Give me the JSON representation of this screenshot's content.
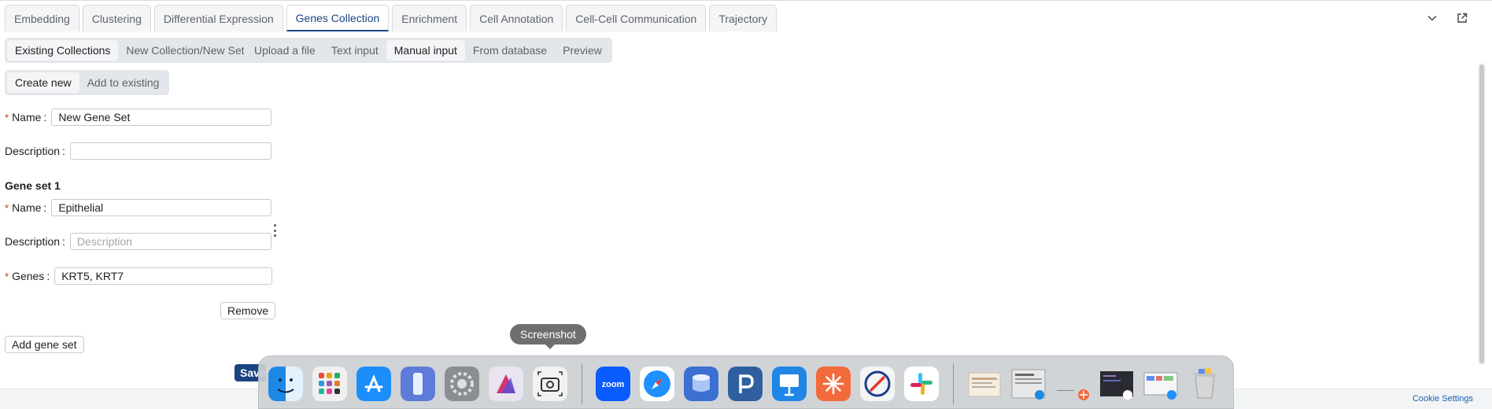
{
  "tabs": [
    {
      "label": "Embedding",
      "active": false
    },
    {
      "label": "Clustering",
      "active": false
    },
    {
      "label": "Differential Expression",
      "active": false
    },
    {
      "label": "Genes Collection",
      "active": true
    },
    {
      "label": "Enrichment",
      "active": false
    },
    {
      "label": "Cell Annotation",
      "active": false
    },
    {
      "label": "Cell-Cell Communication",
      "active": false
    },
    {
      "label": "Trajectory",
      "active": false
    }
  ],
  "collection_mode": {
    "options": [
      "Existing Collections",
      "New Collection/New Set"
    ],
    "selected": "Existing Collections"
  },
  "input_mode": {
    "options": [
      "Upload a file",
      "Text input",
      "Manual input",
      "From database",
      "Preview"
    ],
    "selected": "Manual input"
  },
  "create_mode": {
    "options": [
      "Create new",
      "Add to existing"
    ],
    "selected": "Create new"
  },
  "collection": {
    "name_label": "Name",
    "name_value": "New Gene Set",
    "description_label": "Description",
    "description_value": ""
  },
  "gene_set": {
    "title": "Gene set 1",
    "name_label": "Name",
    "name_value": "Epithelial",
    "description_label": "Description",
    "description_placeholder": "Description",
    "genes_label": "Genes",
    "genes_value": "KRT5, KRT7",
    "remove_label": "Remove"
  },
  "add_gene_set_label": "Add gene set",
  "save_label": "Save",
  "tooltip": "Screenshot",
  "cookie_label": "Cookie Settings",
  "dock_apps": [
    {
      "icon": "finder-icon",
      "color": "#1e88e5"
    },
    {
      "icon": "launchpad-icon",
      "color": "#f0f0f0"
    },
    {
      "icon": "app-store-icon",
      "color": "#1c8ef9"
    },
    {
      "icon": "iphone-mirroring-icon",
      "color": "#5d7bd8"
    },
    {
      "icon": "system-settings-icon",
      "color": "#8a8d93"
    },
    {
      "icon": "affinity-icon",
      "color": "#e9e4f0"
    },
    {
      "icon": "screenshot-icon",
      "color": "#f2f2f2"
    },
    {
      "icon": "zoom-icon",
      "color": "#0b5cff"
    },
    {
      "icon": "safari-icon",
      "color": "#1e90ff"
    },
    {
      "icon": "database-icon",
      "color": "#3b6fd1"
    },
    {
      "icon": "p-app-icon",
      "color": "#2f5f9e"
    },
    {
      "icon": "keynote-icon",
      "color": "#1f86e6"
    },
    {
      "icon": "claude-icon",
      "color": "#f26a3b"
    },
    {
      "icon": "navigator-icon",
      "color": "#f4f4f4"
    },
    {
      "icon": "slack-icon",
      "color": "#ffffff"
    },
    {
      "icon": "document-thumbnail-icon",
      "color": "#f4ede0"
    },
    {
      "icon": "window-thumbnail-icon",
      "color": "#e8e8e8"
    },
    {
      "icon": "minimized-window-icon",
      "color": "#f0f0f0"
    },
    {
      "icon": "terminal-thumbnail-icon",
      "color": "#2a2a33"
    },
    {
      "icon": "browser-thumbnail-icon",
      "color": "#f6f6f6"
    },
    {
      "icon": "trash-icon",
      "color": "#d6d6d6"
    }
  ]
}
